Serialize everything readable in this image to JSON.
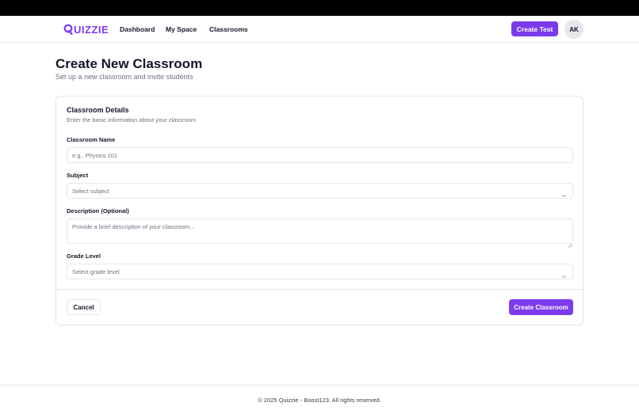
{
  "brand": {
    "name": "UIZZIE",
    "icon": "quizzie-q-logo-icon",
    "color": "#7c3aed"
  },
  "nav": {
    "links": [
      {
        "label": "Dashboard"
      },
      {
        "label": "My Space"
      },
      {
        "label": "Classrooms"
      }
    ],
    "create_test_label": "Create Test",
    "avatar_initials": "AK"
  },
  "page": {
    "title": "Create New Classroom",
    "subtitle": "Set up a new classroom and invite students"
  },
  "card": {
    "title": "Classroom Details",
    "description": "Enter the basic information about your classroom",
    "fields": {
      "name": {
        "label": "Classroom Name",
        "value": "",
        "placeholder": "e.g., Physics 101"
      },
      "subject": {
        "label": "Subject",
        "selected": "Select subject",
        "icon": "chevron-down-icon"
      },
      "description": {
        "label": "Description (Optional)",
        "value": "",
        "placeholder": "Provide a brief description of your classroom..."
      },
      "grade": {
        "label": "Grade Level",
        "selected": "Select grade level",
        "icon": "chevron-down-icon"
      }
    },
    "actions": {
      "cancel_label": "Cancel",
      "submit_label": "Create Classroom"
    }
  },
  "footer": {
    "text": "© 2025 Quizzie - Boost123. All rights reserved."
  },
  "colors": {
    "accent": "#7c3aed",
    "border": "#e5e7eb",
    "muted_text": "#6b7280"
  }
}
